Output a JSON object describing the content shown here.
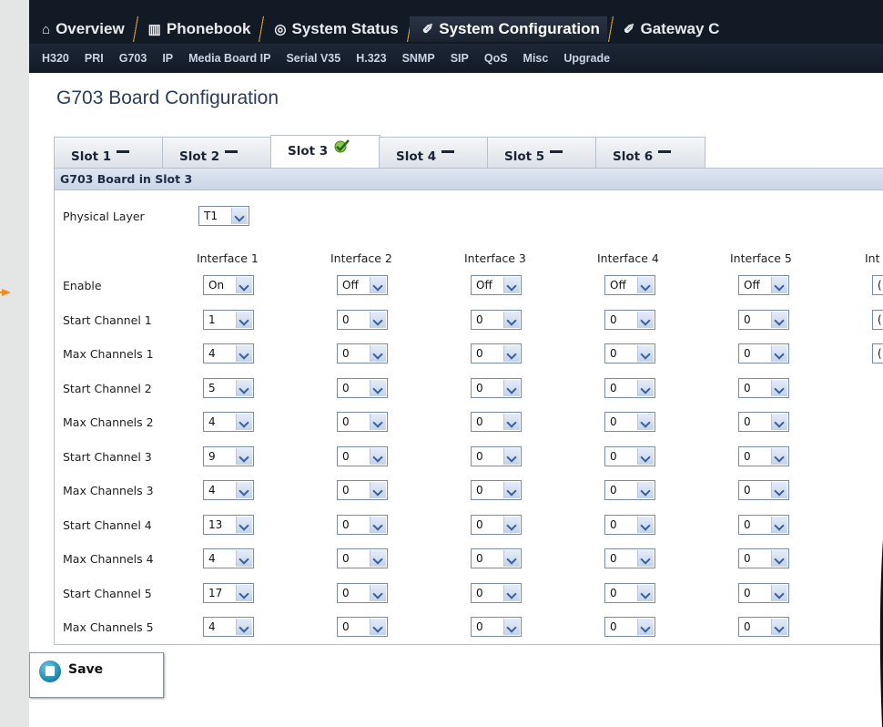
{
  "main_nav": {
    "tabs": [
      {
        "label": "Overview",
        "icon": "home-icon"
      },
      {
        "label": "Phonebook",
        "icon": "book-icon"
      },
      {
        "label": "System Status",
        "icon": "status-icon"
      },
      {
        "label": "System Configuration",
        "icon": "wrench-icon"
      },
      {
        "label": "Gateway C",
        "icon": "wrench-icon"
      }
    ],
    "active_tab": "System Configuration"
  },
  "sub_nav": {
    "items": [
      "H320",
      "PRI",
      "G703",
      "IP",
      "Media Board IP",
      "Serial V35",
      "H.323",
      "SNMP",
      "SIP",
      "QoS",
      "Misc",
      "Upgrade"
    ]
  },
  "page": {
    "title": "G703 Board Configuration"
  },
  "slot_tabs": [
    {
      "label": "Slot 1",
      "icon": "dash-icon"
    },
    {
      "label": "Slot 2",
      "icon": "dash-icon"
    },
    {
      "label": "Slot 3",
      "icon": "check-icon"
    },
    {
      "label": "Slot 4",
      "icon": "dash-icon"
    },
    {
      "label": "Slot 5",
      "icon": "dash-icon"
    },
    {
      "label": "Slot 6",
      "icon": "dash-icon"
    }
  ],
  "active_slot": "Slot 3",
  "panel": {
    "header": "G703 Board in Slot 3",
    "physical_layer_label": "Physical Layer",
    "physical_layer_value": "T1",
    "interfaces": [
      "Interface 1",
      "Interface 2",
      "Interface 3",
      "Interface 4",
      "Interface 5",
      "Int"
    ],
    "rows": [
      {
        "label": "Enable",
        "values": [
          "On",
          "Off",
          "Off",
          "Off",
          "Off",
          "("
        ]
      },
      {
        "label": "Start Channel 1",
        "values": [
          "1",
          "0",
          "0",
          "0",
          "0",
          "("
        ]
      },
      {
        "label": "Max Channels 1",
        "values": [
          "4",
          "0",
          "0",
          "0",
          "0",
          "("
        ]
      },
      {
        "label": "Start Channel 2",
        "values": [
          "5",
          "0",
          "0",
          "0",
          "0",
          ""
        ]
      },
      {
        "label": "Max Channels 2",
        "values": [
          "4",
          "0",
          "0",
          "0",
          "0",
          ""
        ]
      },
      {
        "label": "Start Channel 3",
        "values": [
          "9",
          "0",
          "0",
          "0",
          "0",
          ""
        ]
      },
      {
        "label": "Max Channels 3",
        "values": [
          "4",
          "0",
          "0",
          "0",
          "0",
          ""
        ]
      },
      {
        "label": "Start Channel 4",
        "values": [
          "13",
          "0",
          "0",
          "0",
          "0",
          ""
        ]
      },
      {
        "label": "Max Channels 4",
        "values": [
          "4",
          "0",
          "0",
          "0",
          "0",
          ""
        ]
      },
      {
        "label": "Start Channel 5",
        "values": [
          "17",
          "0",
          "0",
          "0",
          "0",
          ""
        ]
      },
      {
        "label": "Max Channels 5",
        "values": [
          "4",
          "0",
          "0",
          "0",
          "0",
          ""
        ]
      }
    ]
  },
  "save_button": {
    "label": "Save",
    "icon": "save-icon"
  },
  "colors": {
    "nav_bg": "#121a26",
    "accent": "#d69a34",
    "title": "#2b3d59",
    "arrow": "#f08c1c"
  }
}
